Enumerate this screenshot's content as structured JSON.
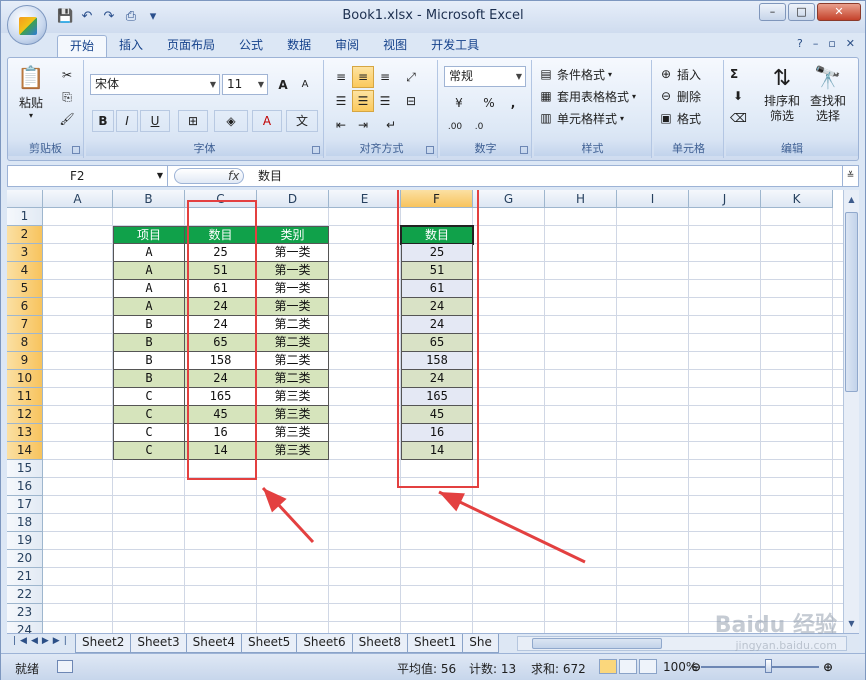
{
  "window": {
    "title": "Book1.xlsx - Microsoft Excel",
    "controls": [
      "–",
      "□",
      "✕"
    ]
  },
  "ribbon_tabs": [
    "开始",
    "插入",
    "页面布局",
    "公式",
    "数据",
    "审阅",
    "视图",
    "开发工具"
  ],
  "ribbon": {
    "clipboard": {
      "label": "剪贴板",
      "paste": "粘贴"
    },
    "font": {
      "label": "字体",
      "name": "宋体",
      "size": "11",
      "grow": "A",
      "shrink": "A",
      "bold": "B",
      "italic": "I",
      "underline": "U",
      "color_a": "A",
      "wen": "文"
    },
    "alignment": {
      "label": "对齐方式"
    },
    "number": {
      "label": "数字",
      "format": "常规",
      "percent": "%",
      "comma": ","
    },
    "styles": {
      "label": "样式",
      "cond": "条件格式",
      "table": "套用表格格式",
      "cell": "单元格样式"
    },
    "cells": {
      "label": "单元格",
      "insert": "插入",
      "delete": "删除",
      "format": "格式"
    },
    "editing": {
      "label": "编辑",
      "sigma": "Σ",
      "sort": "排序和筛选",
      "find": "查找和选择",
      "sort1": "排序和",
      "sort2": "筛选",
      "find1": "查找和",
      "find2": "选择"
    }
  },
  "formula_bar": {
    "cell_ref": "F2",
    "fx": "fx",
    "content": "数目"
  },
  "columns": [
    "A",
    "B",
    "C",
    "D",
    "E",
    "F",
    "G",
    "H",
    "I",
    "J",
    "K"
  ],
  "rows": [
    "1",
    "2",
    "3",
    "4",
    "5",
    "6",
    "7",
    "8",
    "9",
    "10",
    "11",
    "12",
    "13",
    "14",
    "15",
    "16",
    "17",
    "18",
    "19",
    "20",
    "21",
    "22",
    "23",
    "24"
  ],
  "table": {
    "headers": [
      "项目",
      "数目",
      "类别"
    ],
    "rows": [
      [
        "A",
        "25",
        "第一类"
      ],
      [
        "A",
        "51",
        "第一类"
      ],
      [
        "A",
        "61",
        "第一类"
      ],
      [
        "A",
        "24",
        "第一类"
      ],
      [
        "B",
        "24",
        "第二类"
      ],
      [
        "B",
        "65",
        "第二类"
      ],
      [
        "B",
        "158",
        "第二类"
      ],
      [
        "B",
        "24",
        "第二类"
      ],
      [
        "C",
        "165",
        "第三类"
      ],
      [
        "C",
        "45",
        "第三类"
      ],
      [
        "C",
        "16",
        "第三类"
      ],
      [
        "C",
        "14",
        "第三类"
      ]
    ]
  },
  "copy_column": {
    "header": "数目",
    "values": [
      "25",
      "51",
      "61",
      "24",
      "24",
      "65",
      "158",
      "24",
      "165",
      "45",
      "16",
      "14"
    ]
  },
  "sheet_tabs": [
    "Sheet2",
    "Sheet3",
    "Sheet4",
    "Sheet5",
    "Sheet6",
    "Sheet8",
    "Sheet1",
    "She"
  ],
  "status": {
    "mode": "就绪",
    "average": "平均值: 56",
    "count": "计数: 13",
    "sum": "求和: 672",
    "zoom": "100%"
  },
  "watermark": {
    "brand": "Baidu 经验",
    "url": "jingyan.baidu.com"
  },
  "colors": {
    "header_green": "#10a14a",
    "band_green": "#d6e4bc",
    "highlight_red": "#e34040"
  }
}
